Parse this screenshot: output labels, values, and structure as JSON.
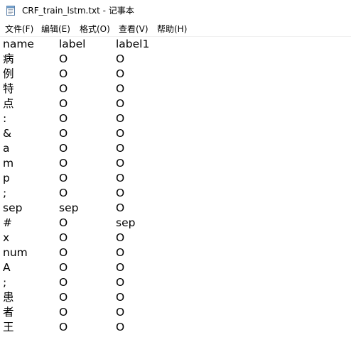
{
  "window": {
    "title": "CRF_train_lstm.txt - 记事本",
    "icon": "notepad-icon"
  },
  "menu": {
    "items": [
      {
        "label": "文件(F)"
      },
      {
        "label": "编辑(E)"
      },
      {
        "label": "格式(O)"
      },
      {
        "label": "查看(V)"
      },
      {
        "label": "帮助(H)"
      }
    ]
  },
  "editor": {
    "lines": [
      [
        "name",
        "label",
        "label1"
      ],
      [
        "病",
        "O",
        "O"
      ],
      [
        "例",
        "O",
        "O"
      ],
      [
        "特",
        "O",
        "O"
      ],
      [
        "点",
        "O",
        "O"
      ],
      [
        ":",
        "O",
        "O"
      ],
      [
        "&",
        "O",
        "O"
      ],
      [
        "a",
        "O",
        "O"
      ],
      [
        "m",
        "O",
        "O"
      ],
      [
        "p",
        "O",
        "O"
      ],
      [
        ";",
        "O",
        "O"
      ],
      [
        "sep",
        "sep",
        "O"
      ],
      [
        "#",
        "O",
        "sep"
      ],
      [
        "x",
        "O",
        "O"
      ],
      [
        "num",
        "O",
        "O"
      ],
      [
        "A",
        "O",
        "O"
      ],
      [
        ";",
        "O",
        "O"
      ],
      [
        "患",
        "O",
        "O"
      ],
      [
        "者",
        "O",
        "O"
      ],
      [
        "王",
        "O",
        "O"
      ]
    ]
  }
}
